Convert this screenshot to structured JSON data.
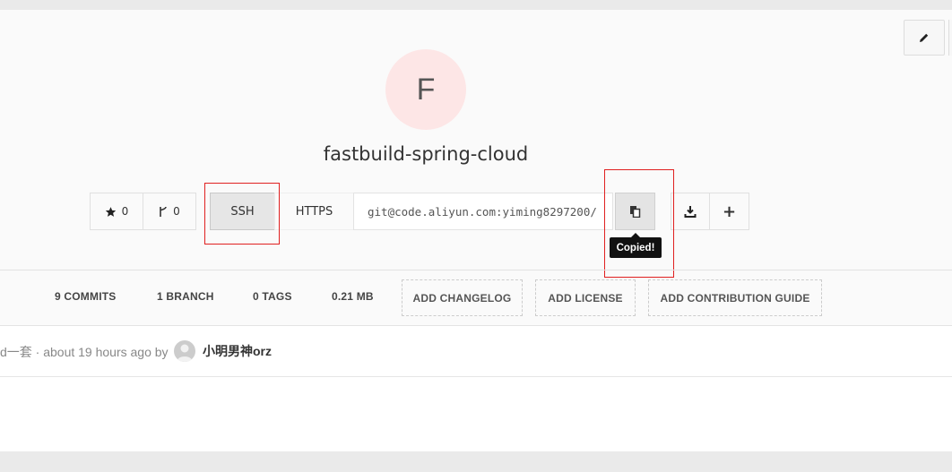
{
  "project": {
    "avatar_letter": "F",
    "name": "fastbuild-spring-cloud"
  },
  "actions": {
    "star_count": "0",
    "fork_count": "0",
    "ssh_label": "SSH",
    "https_label": "HTTPS",
    "clone_url": "git@code.aliyun.com:yiming8297200/",
    "tooltip": "Copied!",
    "plus_label": "+"
  },
  "stats": {
    "commits": "9 COMMITS",
    "branch": "1 BRANCH",
    "tags": "0 TAGS",
    "size": "0.21 MB",
    "add_changelog": "ADD CHANGELOG",
    "add_license": "ADD LICENSE",
    "add_contribution": "ADD CONTRIBUTION GUIDE"
  },
  "commit": {
    "message": "d一套 · about 19 hours ago by",
    "author": "小明男神orz"
  },
  "icons": {
    "edit": "pencil-icon",
    "star": "star-icon",
    "fork": "fork-icon",
    "copy": "clipboard-icon",
    "download": "download-icon"
  },
  "colors": {
    "highlight": "#e02020",
    "avatar_bg": "#fde6e6",
    "tooltip_bg": "#111111"
  }
}
